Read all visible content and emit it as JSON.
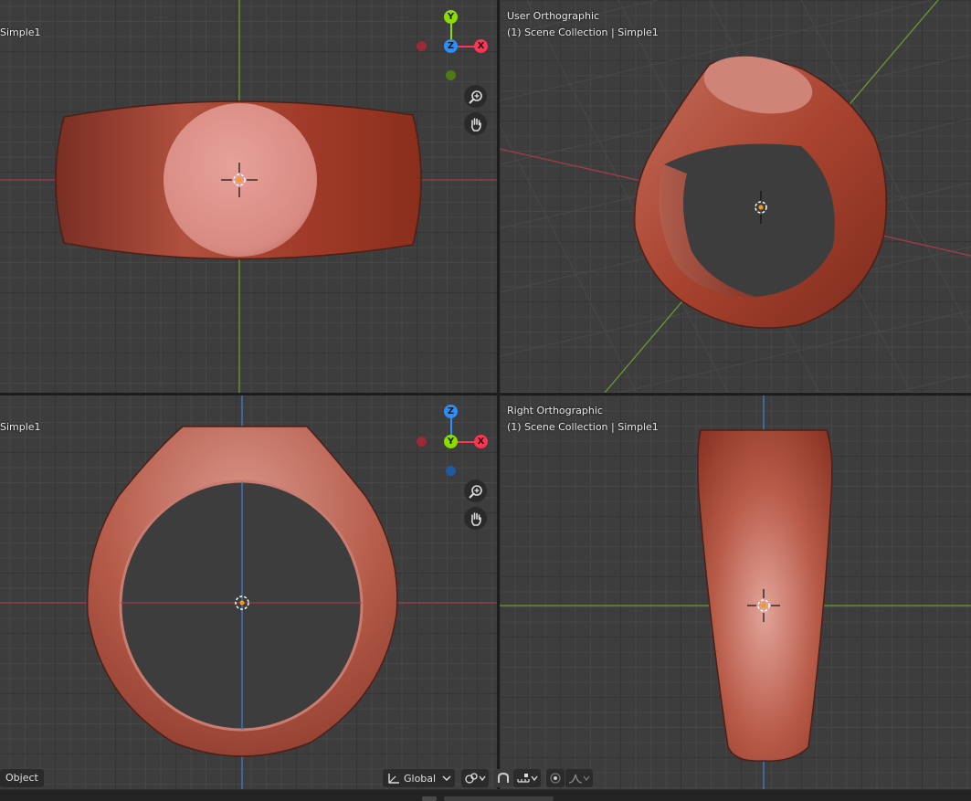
{
  "viewports": {
    "top_left": {
      "label": "Simple1"
    },
    "top_right": {
      "view_name": "User Orthographic",
      "collection": "(1) Scene Collection | Simple1"
    },
    "bottom_left": {
      "label": "Simple1"
    },
    "bottom_right": {
      "view_name": "Right Orthographic",
      "collection": "(1) Scene Collection | Simple1"
    }
  },
  "gizmo": {
    "y_label": "Y",
    "z_label": "Z",
    "x_label": "X"
  },
  "header": {
    "mode": "Object",
    "transform_orientation": "Global"
  },
  "icons": [
    "zoom-icon",
    "hand-pan-icon",
    "transform-orientation-icon",
    "link-icon",
    "snap-magnet-icon",
    "snap-increment-icon",
    "proportional-edit-icon",
    "falloff-curve-icon",
    "chevron-down-icon"
  ],
  "colors": {
    "axis_x": "#a33c49",
    "axis_y": "#6b9a2f",
    "axis_z": "#3f7dcc",
    "gizmo_x": "#ff3352",
    "gizmo_y": "#8bdc00",
    "gizmo_z": "#2890ff",
    "ring": "#b5523f",
    "viewport_bg": "#3d3d3d"
  }
}
